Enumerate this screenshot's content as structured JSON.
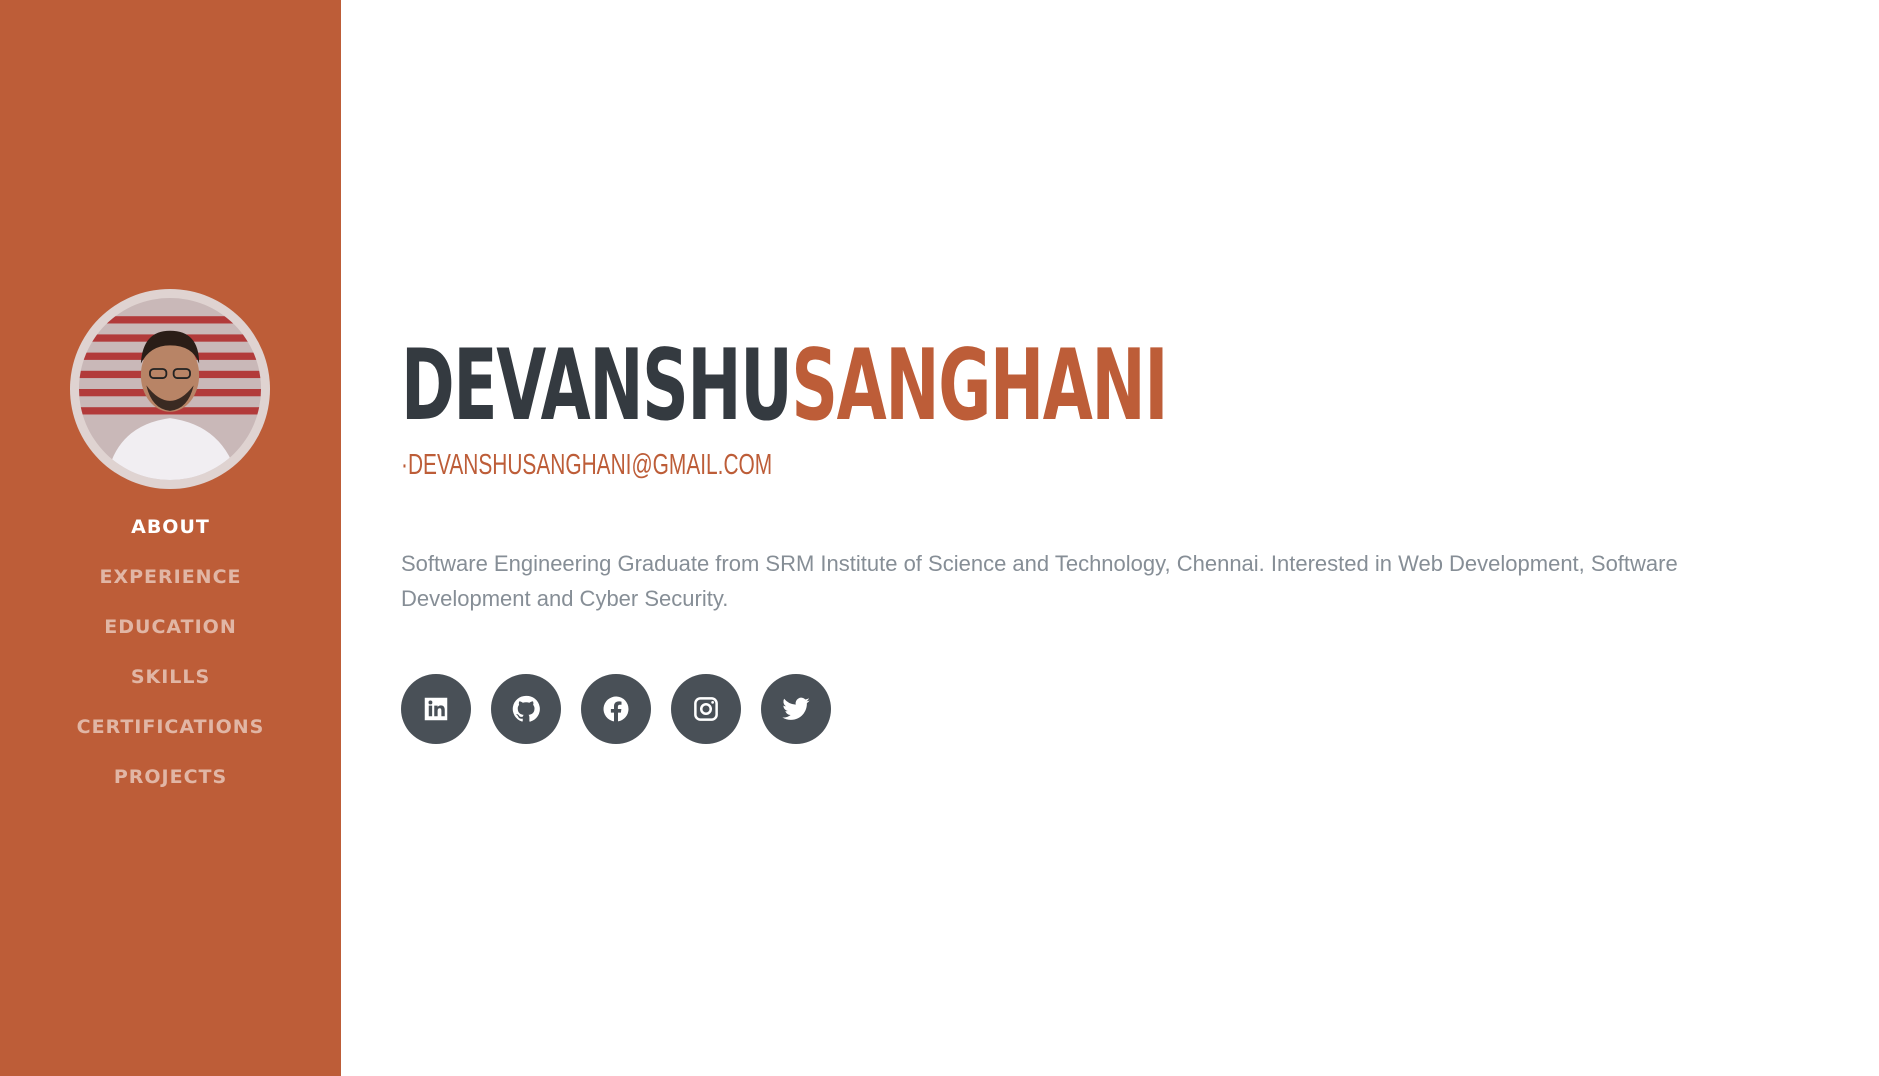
{
  "sidebar": {
    "accent_color": "#bd5d38",
    "avatar_alt": "profile photo",
    "nav": [
      {
        "label": "ABOUT",
        "active": true
      },
      {
        "label": "EXPERIENCE",
        "active": false
      },
      {
        "label": "EDUCATION",
        "active": false
      },
      {
        "label": "SKILLS",
        "active": false
      },
      {
        "label": "CERTIFICATIONS",
        "active": false
      },
      {
        "label": "PROJECTS",
        "active": false
      }
    ]
  },
  "about": {
    "first_name": "DEVANSHU",
    "last_name": "SANGHANI",
    "email": "·DEVANSHUSANGHANI@GMAIL.COM",
    "bio": "Software Engineering Graduate from SRM Institute of Science and Technology, Chennai. Interested in Web Development, Software Development and Cyber Security.",
    "social": [
      {
        "name": "linkedin-icon"
      },
      {
        "name": "github-icon"
      },
      {
        "name": "facebook-icon"
      },
      {
        "name": "instagram-icon"
      },
      {
        "name": "twitter-icon"
      }
    ]
  },
  "colors": {
    "accent": "#bd5d38",
    "heading": "#343a40",
    "body_text": "#868e96",
    "social_bg": "#495057"
  }
}
